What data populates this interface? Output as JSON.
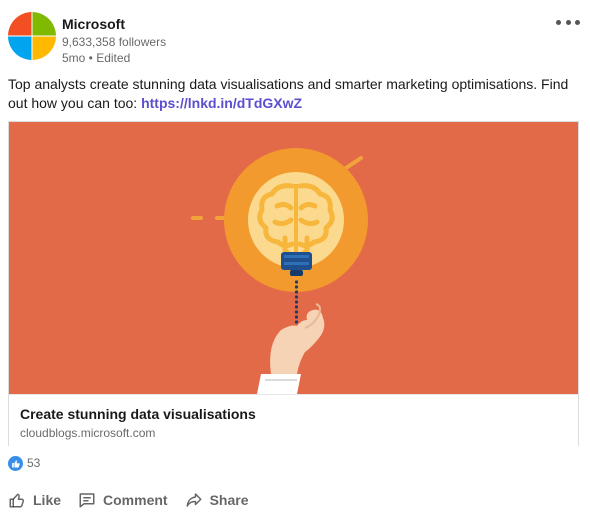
{
  "post": {
    "actor": {
      "name": "Microsoft",
      "followers": "9,633,358 followers",
      "meta": "5mo • Edited",
      "logo_colors": [
        "#f25022",
        "#7fba00",
        "#00a4ef",
        "#ffb900"
      ]
    },
    "menu_icon": "more-horizontal-icon",
    "commentary": {
      "text": "Top analysts create stunning data visualisations and smarter marketing optimisations. Find out how you can too: ",
      "link": "https://lnkd.in/dTdGXwZ"
    },
    "article": {
      "title": "Create stunning data visualisations",
      "source": "cloudblogs.microsoft.com",
      "image_background": "#e36a48"
    },
    "social": {
      "reaction_icon": "like-reaction-icon",
      "count": "53"
    },
    "actions": {
      "like": "Like",
      "comment": "Comment",
      "share": "Share"
    },
    "colors": {
      "link": "#5b4ecf",
      "reaction": "#378fe9"
    }
  }
}
